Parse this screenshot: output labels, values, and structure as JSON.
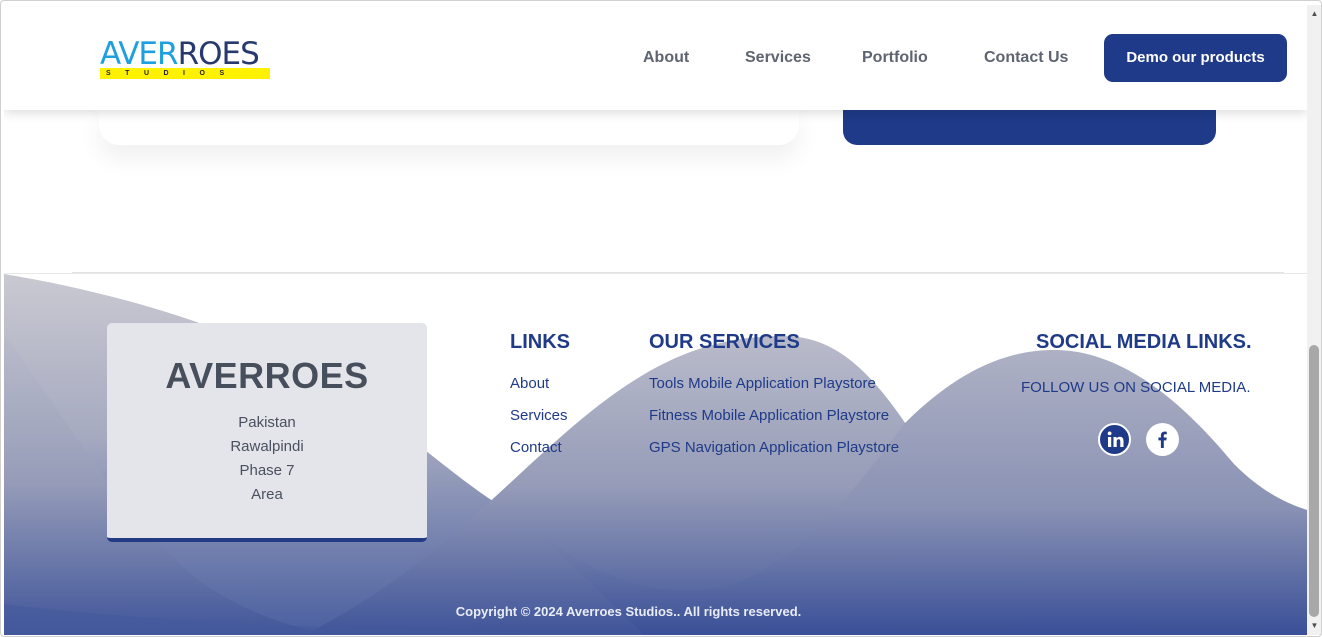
{
  "brand": {
    "logo_word_a": "AVER",
    "logo_word_b": "ROES",
    "logo_tagline": "STUDIOS",
    "colors": {
      "primary": "#1f3a89",
      "logo_blue": "#1ea0e0",
      "logo_yellow": "#fff200"
    }
  },
  "nav": {
    "links": [
      "About",
      "Services",
      "Portfolio",
      "Contact Us"
    ],
    "cta_label": "Demo our products"
  },
  "address_card": {
    "title": "AVERROES",
    "lines": [
      "Pakistan",
      "Rawalpindi",
      "Phase 7",
      "Area"
    ]
  },
  "links_column": {
    "heading": "LINKS",
    "items": [
      "About",
      "Services",
      "Contact"
    ]
  },
  "services_column": {
    "heading": "OUR SERVICES",
    "items": [
      "Tools Mobile Application Playstore",
      "Fitness Mobile Application Playstore",
      "GPS Navigation Application Playstore"
    ]
  },
  "social_column": {
    "heading": "SOCIAL MEDIA LINKS.",
    "subtext": "FOLLOW US ON SOCIAL MEDIA.",
    "icons": [
      "linkedin-icon",
      "facebook-icon"
    ]
  },
  "copyright": "Copyright © 2024 Averroes Studios.. All rights reserved."
}
